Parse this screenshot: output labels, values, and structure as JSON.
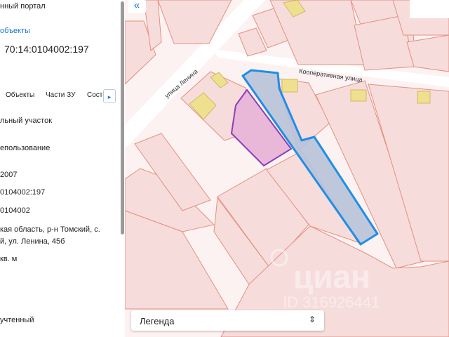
{
  "panel": {
    "portal_title": "нный портал",
    "objects_link": "объекты",
    "cadastral_number": "70:14:0104002:197",
    "tabs": [
      "Объекты",
      "Части ЗУ",
      "Соста"
    ],
    "tab_scroll_icon": "chevron-right-icon",
    "fields": [
      "льный участок",
      "епользование",
      "2007",
      "0104002:197",
      "0104002",
      "кая область, р-н Томский, с.",
      "й, ул. Ленина, 45б",
      "кв. м",
      "учтенный"
    ]
  },
  "map": {
    "collapse_icon": "double-chevron-left-icon",
    "street_lenina": "улица Ленина",
    "street_kooperativnaya": "Кооперативная  улица",
    "watermark_brand": "циан",
    "watermark_id": "ID 316926441",
    "legend_label": "Легенда",
    "legend_icon": "up-down-arrows-icon",
    "colors": {
      "selected_outline": "#1e8fe6",
      "selected_fill": "#b8c2d8",
      "neighbor_fill": "#e9b7d8",
      "neighbor_outline": "#8b3fb8",
      "parcel_fill": "#f7dcdc",
      "parcel_outline": "#e4907f",
      "building_fill": "#eee08f"
    }
  }
}
